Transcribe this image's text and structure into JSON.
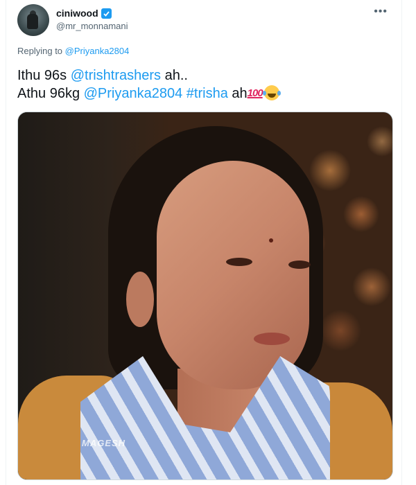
{
  "tweet": {
    "author": {
      "display_name": "ciniwood",
      "handle": "@mr_monnamani",
      "verified_icon": "verified-badge-icon"
    },
    "more_icon": "more-options-icon",
    "replying_prefix": "Replying to ",
    "replying_to": "@Priyanka2804",
    "text_line1_prefix": "Ithu 96s ",
    "text_line1_mention": "@trishtrashers",
    "text_line1_suffix": " ah..",
    "text_line2_prefix": "Athu 96kg ",
    "text_line2_mention": "@Priyanka2804",
    "text_line2_hashtag": "#trisha",
    "text_line2_suffix": " ah",
    "emoji_hundred": "100",
    "emoji_laughing": "tears-of-joy-emoji",
    "media": {
      "watermark": "MAGESH"
    }
  },
  "colors": {
    "link": "#1d9bf0",
    "text": "#0f1419",
    "secondary": "#536471"
  }
}
